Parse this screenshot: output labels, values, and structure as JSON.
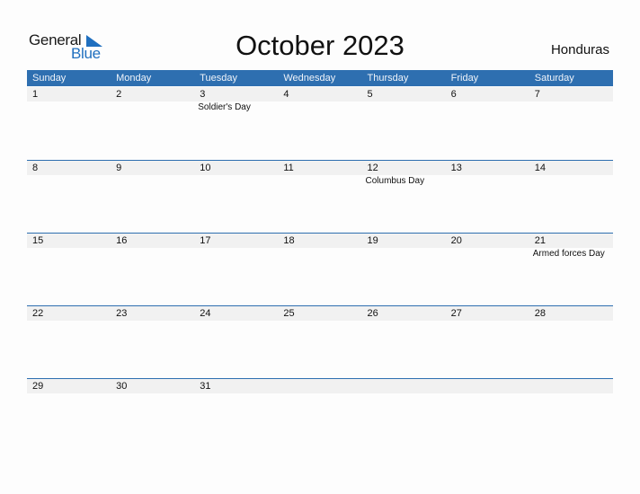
{
  "logo": {
    "word1": "General",
    "word2": "Blue"
  },
  "title": "October 2023",
  "country": "Honduras",
  "colors": {
    "accent": "#2e6fb0",
    "date_strip": "#f1f1f1",
    "logo_blue": "#1f6fbf"
  },
  "weekdays": [
    "Sunday",
    "Monday",
    "Tuesday",
    "Wednesday",
    "Thursday",
    "Friday",
    "Saturday"
  ],
  "weeks": [
    [
      {
        "day": "1",
        "holiday": ""
      },
      {
        "day": "2",
        "holiday": ""
      },
      {
        "day": "3",
        "holiday": "Soldier's Day"
      },
      {
        "day": "4",
        "holiday": ""
      },
      {
        "day": "5",
        "holiday": ""
      },
      {
        "day": "6",
        "holiday": ""
      },
      {
        "day": "7",
        "holiday": ""
      }
    ],
    [
      {
        "day": "8",
        "holiday": ""
      },
      {
        "day": "9",
        "holiday": ""
      },
      {
        "day": "10",
        "holiday": ""
      },
      {
        "day": "11",
        "holiday": ""
      },
      {
        "day": "12",
        "holiday": "Columbus Day"
      },
      {
        "day": "13",
        "holiday": ""
      },
      {
        "day": "14",
        "holiday": ""
      }
    ],
    [
      {
        "day": "15",
        "holiday": ""
      },
      {
        "day": "16",
        "holiday": ""
      },
      {
        "day": "17",
        "holiday": ""
      },
      {
        "day": "18",
        "holiday": ""
      },
      {
        "day": "19",
        "holiday": ""
      },
      {
        "day": "20",
        "holiday": ""
      },
      {
        "day": "21",
        "holiday": "Armed forces Day"
      }
    ],
    [
      {
        "day": "22",
        "holiday": ""
      },
      {
        "day": "23",
        "holiday": ""
      },
      {
        "day": "24",
        "holiday": ""
      },
      {
        "day": "25",
        "holiday": ""
      },
      {
        "day": "26",
        "holiday": ""
      },
      {
        "day": "27",
        "holiday": ""
      },
      {
        "day": "28",
        "holiday": ""
      }
    ],
    [
      {
        "day": "29",
        "holiday": ""
      },
      {
        "day": "30",
        "holiday": ""
      },
      {
        "day": "31",
        "holiday": ""
      },
      {
        "day": "",
        "holiday": ""
      },
      {
        "day": "",
        "holiday": ""
      },
      {
        "day": "",
        "holiday": ""
      },
      {
        "day": "",
        "holiday": ""
      }
    ]
  ]
}
